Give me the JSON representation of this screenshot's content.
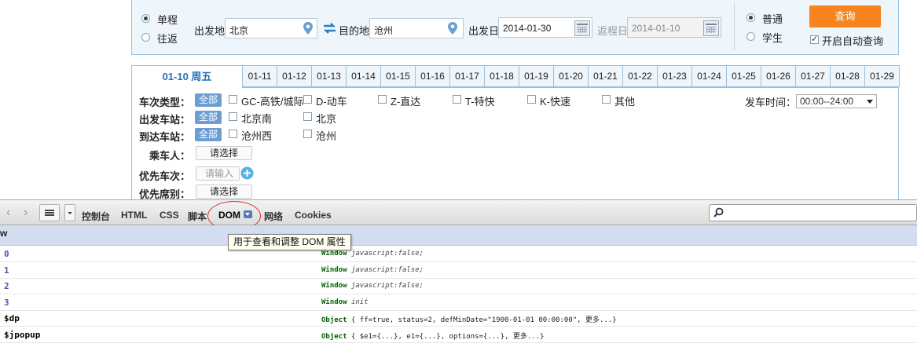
{
  "search": {
    "trip_types": [
      {
        "label": "单程",
        "selected": true
      },
      {
        "label": "往返",
        "selected": false
      }
    ],
    "from_label": "出发地",
    "from_value": "北京",
    "to_label": "目的地",
    "to_value": "沧州",
    "depart_label": "出发日",
    "depart_value": "2014-01-30",
    "return_label": "返程日",
    "return_value": "2014-01-10",
    "passenger_types": [
      {
        "label": "普通",
        "selected": true
      },
      {
        "label": "学生",
        "selected": false
      }
    ],
    "query_label": "查询",
    "auto_query_label": "开启自动查询",
    "auto_query_checked": true
  },
  "date_tabs": {
    "active": "01-10 周五",
    "dates": [
      "01-11",
      "01-12",
      "01-13",
      "01-14",
      "01-15",
      "01-16",
      "01-17",
      "01-18",
      "01-19",
      "01-20",
      "01-21",
      "01-22",
      "01-23",
      "01-24",
      "01-25",
      "01-26",
      "01-27",
      "01-28",
      "01-29"
    ]
  },
  "filters": {
    "all_label": "全部",
    "train_type_label": "车次类型：",
    "train_types": [
      "GC-高铁/城际",
      "D-动车",
      "Z-直达",
      "T-特快",
      "K-快速",
      "其他"
    ],
    "depart_station_label": "出发车站：",
    "depart_stations": [
      "北京南",
      "北京"
    ],
    "arrive_station_label": "到达车站：",
    "arrive_stations": [
      "沧州西",
      "沧州"
    ],
    "passenger_label": "乘车人：",
    "passenger_pick": "请选择",
    "priority_train_label": "优先车次：",
    "priority_train_placeholder": "请输入",
    "priority_seat_label": "优先席别：",
    "priority_seat_pick": "请选择",
    "depart_time_label": "发车时间：",
    "depart_time_value": "00:00--24:00"
  },
  "devtools": {
    "tabs": [
      "控制台",
      "HTML",
      "CSS",
      "脚本",
      "DOM",
      "网络",
      "Cookies"
    ],
    "active_tab": "DOM",
    "header_text": "w",
    "tooltip": "用于查看和调整 DOM 属性",
    "rows": [
      {
        "key": "0",
        "type": "Window",
        "detail": "javascript:false;",
        "key_color": "#5b4fb0"
      },
      {
        "key": "1",
        "type": "Window",
        "detail": "javascript:false;",
        "key_color": "#5b4fb0"
      },
      {
        "key": "2",
        "type": "Window",
        "detail": "javascript:false;",
        "key_color": "#5b4fb0"
      },
      {
        "key": "3",
        "type": "Window",
        "detail": "init",
        "key_color": "#5b4fb0"
      },
      {
        "key": "$dp",
        "type": "Object",
        "detail": "{ ff=true,  status=2,  defMinDate=\"1900-01-01 00:00:00\",  更多...}",
        "key_color": "#000000"
      },
      {
        "key": "$jpopup",
        "type": "Object",
        "detail": "{ $e1={...},  e1={...},  options={...},  更多...}",
        "key_color": "#000000"
      }
    ]
  },
  "colors": {
    "accent": "#f7841f",
    "panel_bg": "#eef5fb",
    "tab_active_text": "#2a6fb5",
    "all_badge": "#6c9ed3",
    "devtools_header": "#d2def0"
  }
}
